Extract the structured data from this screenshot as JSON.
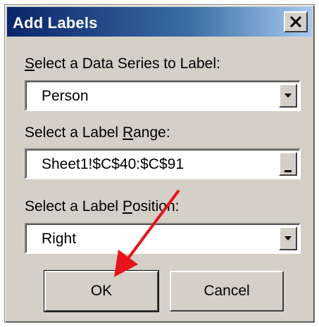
{
  "window": {
    "title": "Add Labels",
    "close_glyph": "×"
  },
  "series": {
    "label_pre": "",
    "label_u": "S",
    "label_post": "elect a Data Series to Label:",
    "value": "Person"
  },
  "range": {
    "label_pre": "Select a Label ",
    "label_u": "R",
    "label_post": "ange:",
    "value": "Sheet1!$C$40:$C$91"
  },
  "position": {
    "label_pre": "Select a Label ",
    "label_u": "P",
    "label_post": "osition:",
    "value": "Right"
  },
  "buttons": {
    "ok": "OK",
    "cancel": "Cancel"
  },
  "colors": {
    "dialog_bg": "#d4d0c8",
    "titlebar_start": "#0a246a",
    "titlebar_end": "#a6caf0",
    "arrow": "#e8141b"
  },
  "icons": {
    "close": "close-icon",
    "dropdown": "chevron-down-icon",
    "range_picker": "collapse-dialog-icon",
    "annotation": "red-arrow"
  }
}
